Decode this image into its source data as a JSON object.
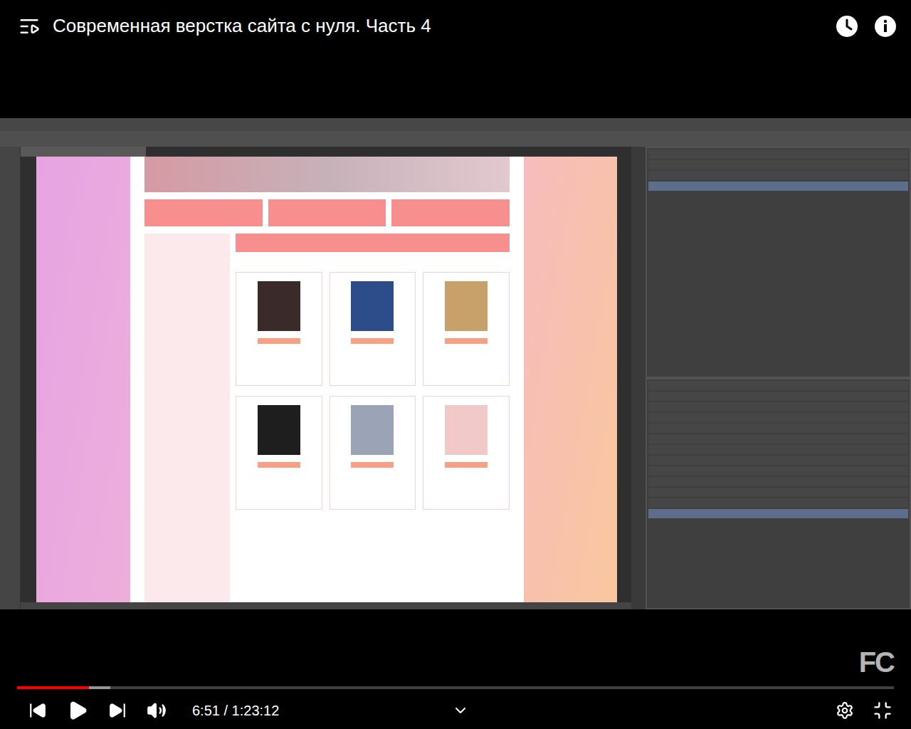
{
  "video": {
    "title": "Современная верстка сайта с нуля. Часть 4",
    "watermark": "FC"
  },
  "player": {
    "playing": false,
    "progress": {
      "level": 0.082,
      "buffered": 0.106
    },
    "time": "6:51 / 1:23:12"
  }
}
